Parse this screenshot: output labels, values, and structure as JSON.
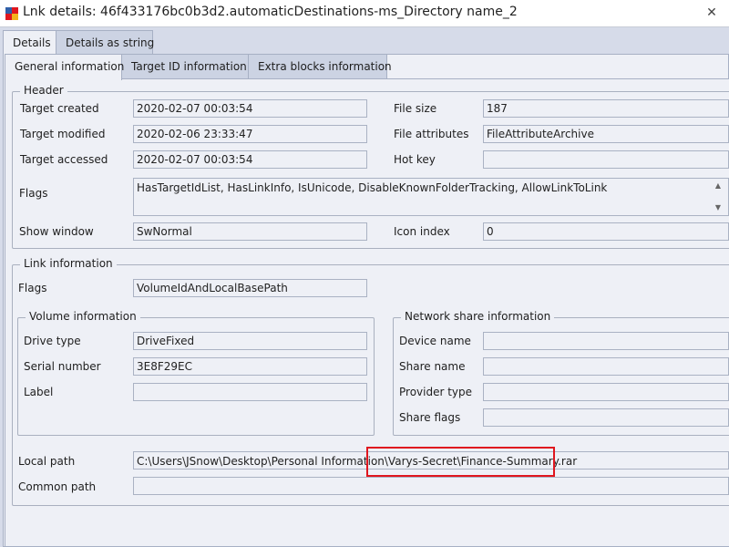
{
  "window": {
    "title": "Lnk details: 46f433176bc0b3d2.automaticDestinations-ms_Directory name_2",
    "close_glyph": "✕",
    "app_icon": "lnk-details-app-icon"
  },
  "outer_tabs": [
    {
      "label": "Details",
      "active": true
    },
    {
      "label": "Details as string",
      "active": false
    }
  ],
  "inner_tabs": [
    {
      "label": "General information",
      "active": true
    },
    {
      "label": "Target ID information",
      "active": false
    },
    {
      "label": "Extra blocks information",
      "active": false
    }
  ],
  "header": {
    "title": "Header",
    "target_created_label": "Target created",
    "target_created": "2020-02-07 00:03:54",
    "target_modified_label": "Target modified",
    "target_modified": "2020-02-06 23:33:47",
    "target_accessed_label": "Target accessed",
    "target_accessed": "2020-02-07 00:03:54",
    "file_size_label": "File size",
    "file_size": "187",
    "file_attributes_label": "File attributes",
    "file_attributes": "FileAttributeArchive",
    "hot_key_label": "Hot key",
    "hot_key": "",
    "flags_label": "Flags",
    "flags": "HasTargetIdList, HasLinkInfo, IsUnicode, DisableKnownFolderTracking, AllowLinkToLink",
    "show_window_label": "Show window",
    "show_window": "SwNormal",
    "icon_index_label": "Icon index",
    "icon_index": "0"
  },
  "link_info": {
    "title": "Link information",
    "flags_label": "Flags",
    "flags": "VolumeIdAndLocalBasePath",
    "volume": {
      "title": "Volume information",
      "drive_type_label": "Drive type",
      "drive_type": "DriveFixed",
      "serial_number_label": "Serial number",
      "serial_number": "3E8F29EC",
      "label_label": "Label",
      "label": ""
    },
    "network": {
      "title": "Network share information",
      "device_name_label": "Device name",
      "device_name": "",
      "share_name_label": "Share name",
      "share_name": "",
      "provider_type_label": "Provider type",
      "provider_type": "",
      "share_flags_label": "Share flags",
      "share_flags": ""
    },
    "local_path_label": "Local path",
    "local_path": "C:\\Users\\JSnow\\Desktop\\Personal Information\\Varys-Secret\\Finance-Summary.rar",
    "common_path_label": "Common path",
    "common_path": ""
  },
  "colors": {
    "highlight_box": "#e0161e",
    "panel_bg": "#eef0f6",
    "chrome_bg": "#d6dbe9"
  }
}
